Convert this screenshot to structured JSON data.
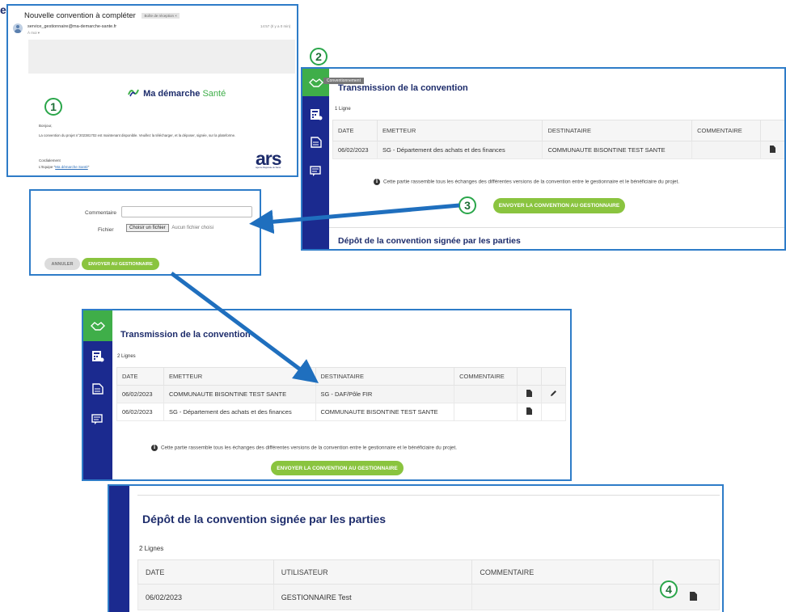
{
  "email": {
    "subject": "Nouvelle convention à compléter",
    "inbox_tag": "Boîte de réception ×",
    "sender": "service_gestionnaire@ma-demarche-sante.fr",
    "to_me": "À moi ▾",
    "time": "14:57 (Il y a 0 min)",
    "brand_prefix": "Ma démarche",
    "brand_suffix": "Santé",
    "greeting": "Bonjour,",
    "body": "La convention du projet n°202381702 est maintenant disponible. Veuillez la télécharger, et la déposer, signée, sur la plateforme.",
    "signoff": "Cordialement",
    "team_prefix": "L'Equipe \"",
    "team_link": "Ma démarche Santé",
    "team_suffix": "\"",
    "ars_logo": "ars",
    "ars_sub": "Agence Régionale de Santé",
    "cut_letter": "e"
  },
  "badges": {
    "b1": "1",
    "b2": "2",
    "b3": "3",
    "b4": "4"
  },
  "sidebar_icons": [
    "handshake-icon",
    "calculator-icon",
    "folder-icon",
    "chat-icon"
  ],
  "transmission1": {
    "tooltip": "Conventionnement",
    "title": "Transmission de la convention",
    "count": "1 Ligne",
    "headers": [
      "DATE",
      "EMETTEUR",
      "DESTINATAIRE",
      "COMMENTAIRE"
    ],
    "rows": [
      {
        "date": "06/02/2023",
        "emetteur": "SG - Département des achats et des finances",
        "destinataire": "COMMUNAUTE BISONTINE TEST SANTE",
        "commentaire": ""
      }
    ],
    "info": "Cette partie rassemble tous les échanges des différentes versions de la convention entre le gestionnaire et le bénéficiaire du projet.",
    "send_button": "ENVOYER LA CONVENTION AU GESTIONNAIRE",
    "depot_title": "Dépôt de la convention signée par les parties"
  },
  "upload_form": {
    "comment_label": "Commentaire",
    "comment_value": "",
    "file_label": "Fichier",
    "choose_button": "Choisir un fichier",
    "no_file_text": "Aucun fichier choisi",
    "cancel_button": "ANNULER",
    "submit_button": "ENVOYER AU GESTIONNAIRE"
  },
  "transmission2": {
    "title": "Transmission de la convention",
    "count": "2 Lignes",
    "headers": [
      "DATE",
      "EMETTEUR",
      "DESTINATAIRE",
      "COMMENTAIRE"
    ],
    "rows": [
      {
        "date": "06/02/2023",
        "emetteur": "COMMUNAUTE BISONTINE TEST SANTE",
        "destinataire": "SG - DAF/Pôle FIR",
        "commentaire": ""
      },
      {
        "date": "06/02/2023",
        "emetteur": "SG - Département des achats et des finances",
        "destinataire": "COMMUNAUTE BISONTINE TEST SANTE",
        "commentaire": ""
      }
    ],
    "info": "Cette partie rassemble tous les échanges des différentes versions de la convention entre le gestionnaire et le bénéficiaire du projet.",
    "send_button": "ENVOYER LA CONVENTION AU GESTIONNAIRE"
  },
  "depot": {
    "title": "Dépôt de la convention signée par les parties",
    "count": "2 Lignes",
    "headers": [
      "DATE",
      "UTILISATEUR",
      "COMMENTAIRE"
    ],
    "rows": [
      {
        "date": "06/02/2023",
        "utilisateur": "GESTIONNAIRE Test",
        "commentaire": ""
      }
    ]
  },
  "colors": {
    "accent_green": "#8ac43f",
    "sidebar_navy": "#1b2a8f",
    "panel_border": "#2e7cc8",
    "arrow": "#1f6fbe",
    "badge_green": "#2aa64a"
  }
}
